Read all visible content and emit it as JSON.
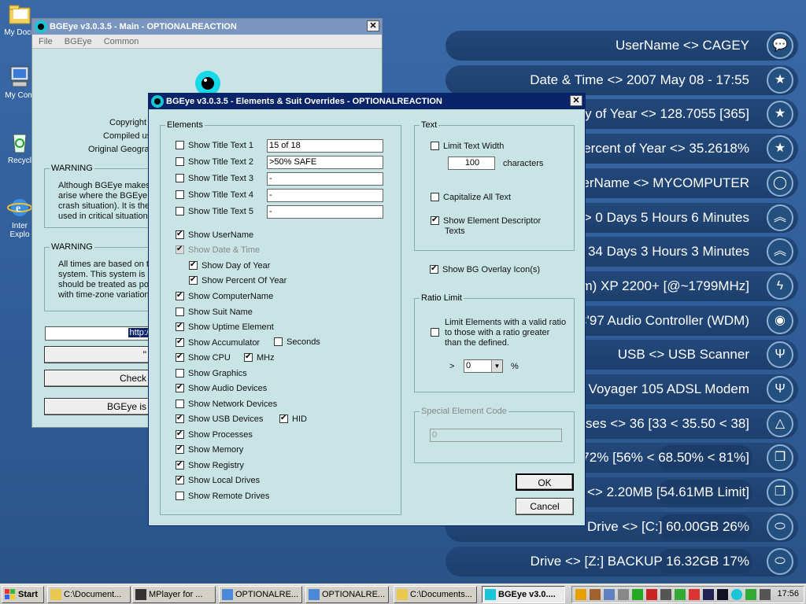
{
  "desktop_icons": [
    {
      "label": "My Docu",
      "icon": "folder-icon"
    },
    {
      "label": "My Com",
      "icon": "computer-icon"
    },
    {
      "label": "Recycl",
      "icon": "recycle-bin-icon"
    },
    {
      "label": "Inter",
      "label2": "Explo",
      "icon": "internet-explorer-icon"
    }
  ],
  "stats": [
    {
      "text": "UserName <> CAGEY",
      "icon": "speech-bubble-icon"
    },
    {
      "text": "Date & Time <> 2007 May 08 - 17:55",
      "icon": "star-icon"
    },
    {
      "text": "ay of Year <> 128.7055 [365]",
      "icon": "star-icon"
    },
    {
      "text": "Percent of Year <> 35.2618%",
      "icon": "star-icon"
    },
    {
      "text": "uterName <> MYCOMPUTER",
      "icon": "ring-icon"
    },
    {
      "text": "<> 0 Days 5 Hours 6 Minutes",
      "icon": "double-chevron-up-icon"
    },
    {
      "text": "> 34 Days 3 Hours 3 Minutes",
      "icon": "double-chevron-up-icon"
    },
    {
      "text": "(tm) XP 2200+ [@~1799MHz]",
      "icon": "lightning-icon"
    },
    {
      "text": "C'97 Audio Controller (WDM)",
      "icon": "disc-icon"
    },
    {
      "text": "USB <> USB Scanner",
      "icon": "usb-icon"
    },
    {
      "text": "T Voyager 105 ADSL Modem",
      "icon": "usb-icon"
    },
    {
      "text": "esses <> 36 [33 < 35.50 < 38]",
      "icon": "triangle-icon"
    },
    {
      "text": "3 72% [56% < 68.50% < 81%]",
      "icon": "windows-stack-icon"
    },
    {
      "text": "ry <> 2.20MB [54.61MB Limit]",
      "icon": "windows-stack-icon"
    },
    {
      "text": "Drive <> [C:] 60.00GB 26%",
      "icon": "drive-icon"
    },
    {
      "text": "Drive <> [Z:] BACKUP 16.32GB 17%",
      "icon": "drive-icon"
    }
  ],
  "main_window": {
    "title": "BGEye v3.0.3.5 - Main - OPTIONALREACTION",
    "menu": [
      "File",
      "BGEye",
      "Common"
    ],
    "copyright": "Copyright",
    "compiled": "Compiled us",
    "original": "Original Geograp",
    "warning1_label": "WARNING",
    "warning1_lines": [
      "Although BGEye makes",
      "arise where the BGEye '",
      "crash situation). It is ther",
      "used in critical situations"
    ],
    "warning2_label": "WARNING",
    "warning2_lines": [
      "All times are based on tir",
      "system. This system is p",
      "should be treated as pos",
      "with time-zone variations"
    ],
    "url_text": "http:/",
    "btn_blank": "\"",
    "btn_check": "Check",
    "btn_bgeye": "BGEye is"
  },
  "dialog": {
    "title": "BGEye v3.0.3.5 - Elements & Suit Overrides - OPTIONALREACTION",
    "elements_label": "Elements",
    "title_texts": [
      {
        "label": "Show Title Text 1",
        "value": "15 of 18",
        "checked": false
      },
      {
        "label": "Show Title Text 2",
        "value": ">50% SAFE",
        "checked": false
      },
      {
        "label": "Show Title Text 3",
        "value": "-",
        "checked": false
      },
      {
        "label": "Show Title Text 4",
        "value": "-",
        "checked": false
      },
      {
        "label": "Show Title Text 5",
        "value": "-",
        "checked": false
      }
    ],
    "show_username": "Show UserName",
    "show_datetime": "Show Date & Time",
    "show_day_of_year": "Show Day of Year",
    "show_percent_of_year": "Show Percent Of Year",
    "items": [
      {
        "label": "Show ComputerName",
        "checked": true
      },
      {
        "label": "Show Suit Name",
        "checked": false
      },
      {
        "label": "Show Uptime Element",
        "checked": true
      },
      {
        "label": "Show Accumulator",
        "checked": true
      },
      {
        "label": "Show CPU",
        "checked": true
      },
      {
        "label": "Show Graphics",
        "checked": false
      },
      {
        "label": "Show Audio Devices",
        "checked": true
      },
      {
        "label": "Show Network Devices",
        "checked": false
      },
      {
        "label": "Show USB Devices",
        "checked": true
      },
      {
        "label": "Show Processes",
        "checked": true
      },
      {
        "label": "Show Memory",
        "checked": true
      },
      {
        "label": "Show Registry",
        "checked": true
      },
      {
        "label": "Show Local Drives",
        "checked": true
      },
      {
        "label": "Show Remote Drives",
        "checked": false
      }
    ],
    "seconds": "Seconds",
    "mhz": "MHz",
    "hid": "HID",
    "text_group": "Text",
    "limit_text_width": "Limit Text Width",
    "width_value": "100",
    "characters": "characters",
    "capitalize": "Capitalize All Text",
    "show_descriptor_1": "Show Element Descriptor",
    "show_descriptor_2": "Texts",
    "show_bg_overlay": "Show BG Overlay Icon(s)",
    "ratio_group": "Ratio Limit",
    "ratio_line1": "Limit Elements with a valid ratio",
    "ratio_line2": "to those with a ratio greater",
    "ratio_line3": "than the defined.",
    "ratio_gt": ">",
    "ratio_value": "0",
    "ratio_pct": "%",
    "special_group": "Special Element Code",
    "special_value": "0",
    "ok": "OK",
    "cancel": "Cancel"
  },
  "taskbar": {
    "start": "Start",
    "buttons": [
      "C:\\Document...",
      "MPlayer for ...",
      "OPTIONALRE...",
      "OPTIONALRE...",
      "C:\\Documents...",
      "BGEye v3.0...."
    ],
    "clock": "17:56"
  },
  "colors": {
    "title_active": "#0a246a",
    "title_inactive": "#7a96c0",
    "window_bg": "#c8e4e4",
    "desktop": "#2f5c96"
  }
}
